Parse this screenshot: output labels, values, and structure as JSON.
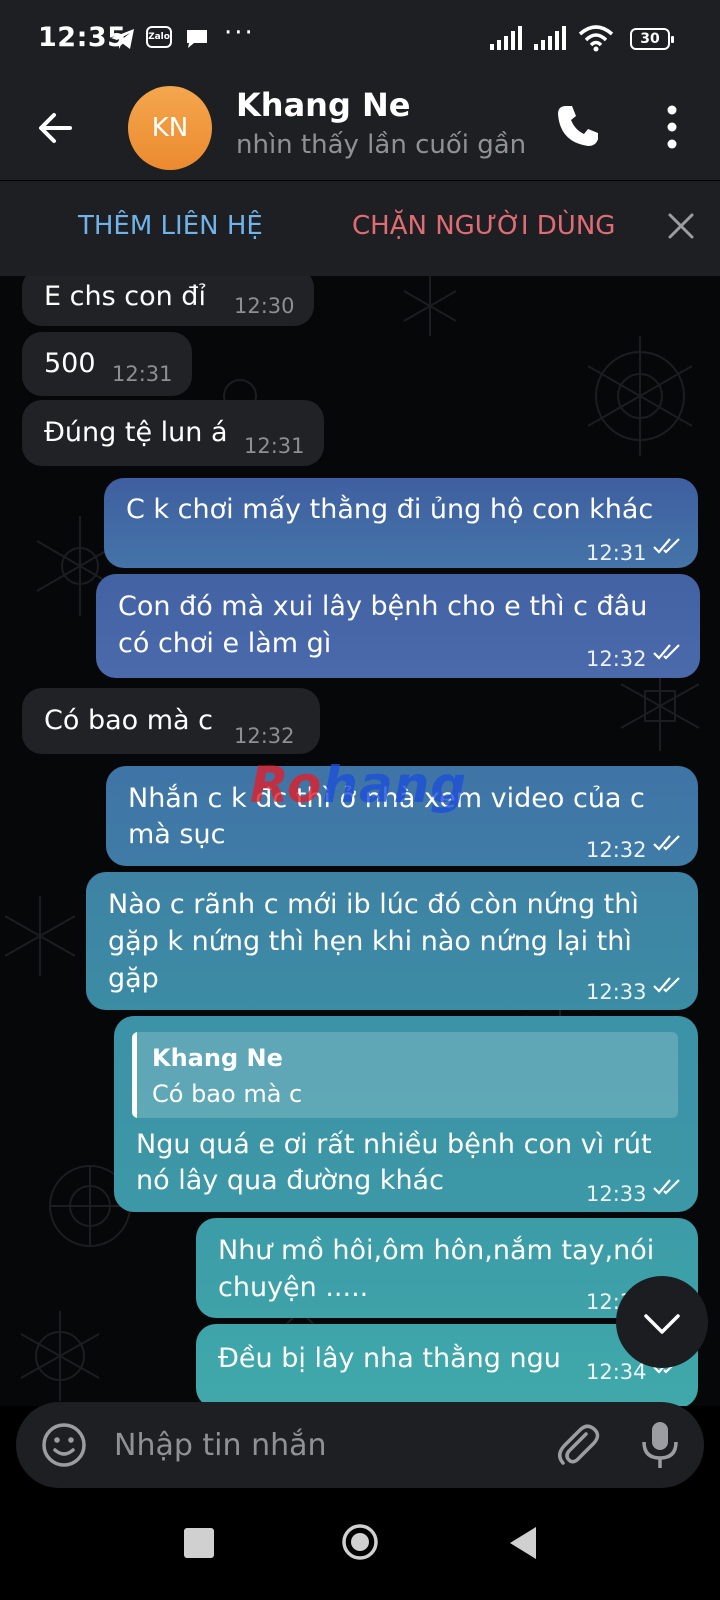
{
  "status_bar": {
    "time": "12:35",
    "battery": "30",
    "icons": [
      "telegram-icon",
      "zalo-icon",
      "chat-icon",
      "more-dots-icon",
      "signal-icon",
      "signal-icon",
      "wifi-icon",
      "battery-icon"
    ],
    "dots": "···",
    "zalo": "Zalo"
  },
  "header": {
    "avatar_initials": "KN",
    "name": "Khang Ne",
    "status": "nhìn thấy lần cuối gần đây",
    "avatar_color": "#ef953a"
  },
  "action_bar": {
    "add_contact": "THÊM LIÊN HỆ",
    "block_user": "CHẶN NGƯỜI DÙNG"
  },
  "messages": [
    {
      "dir": "in",
      "text": [
        "E chs con đỉ"
      ],
      "time": "12:30"
    },
    {
      "dir": "in",
      "text": [
        "500"
      ],
      "time": "12:31"
    },
    {
      "dir": "in",
      "text": [
        "Đúng tệ lun á"
      ],
      "time": "12:31"
    },
    {
      "dir": "out",
      "text": [
        "C k chơi mấy thằng đi ủng hộ con khác"
      ],
      "time": "12:31"
    },
    {
      "dir": "out",
      "text": [
        "Con đó mà xui lây bệnh cho e thì c đâu",
        "có chơi e làm gì"
      ],
      "time": "12:32"
    },
    {
      "dir": "in",
      "text": [
        "Có bao mà c"
      ],
      "time": "12:32"
    },
    {
      "dir": "out",
      "text": [
        "Nhắn c k đc thì ở nhà xem video của c",
        "mà sục"
      ],
      "time": "12:32"
    },
    {
      "dir": "out",
      "text": [
        "Nào c rãnh c mới ib lúc đó còn nứng thì",
        "gặp k nứng thì hẹn khi nào nứng lại thì",
        "gặp"
      ],
      "time": "12:33"
    },
    {
      "dir": "out",
      "reply": {
        "name": "Khang Ne",
        "text": "Có bao mà c"
      },
      "text": [
        "Ngu quá e ơi rất nhiều bệnh con vì rút",
        "nó lây qua đường khác"
      ],
      "time": "12:33"
    },
    {
      "dir": "out",
      "text": [
        "Như mồ hôi,ôm hôn,nắm tay,nói",
        "chuyện ....."
      ],
      "time": "12:3"
    },
    {
      "dir": "out",
      "text": [
        "Đều bị lây nha thằng ngu"
      ],
      "time": "12:34"
    }
  ],
  "watermark": {
    "part1": "Ro",
    "part2": "hang"
  },
  "input": {
    "placeholder": "Nhập tin nhắn"
  },
  "colors": {
    "bar_bg": "#1e1f22",
    "incoming_bubble": "#212226",
    "outgoing_top": "#3e5ea0",
    "outgoing_bottom": "#46a3a6",
    "add_contact": "#6fb3ea",
    "block_user": "#e06c75"
  }
}
